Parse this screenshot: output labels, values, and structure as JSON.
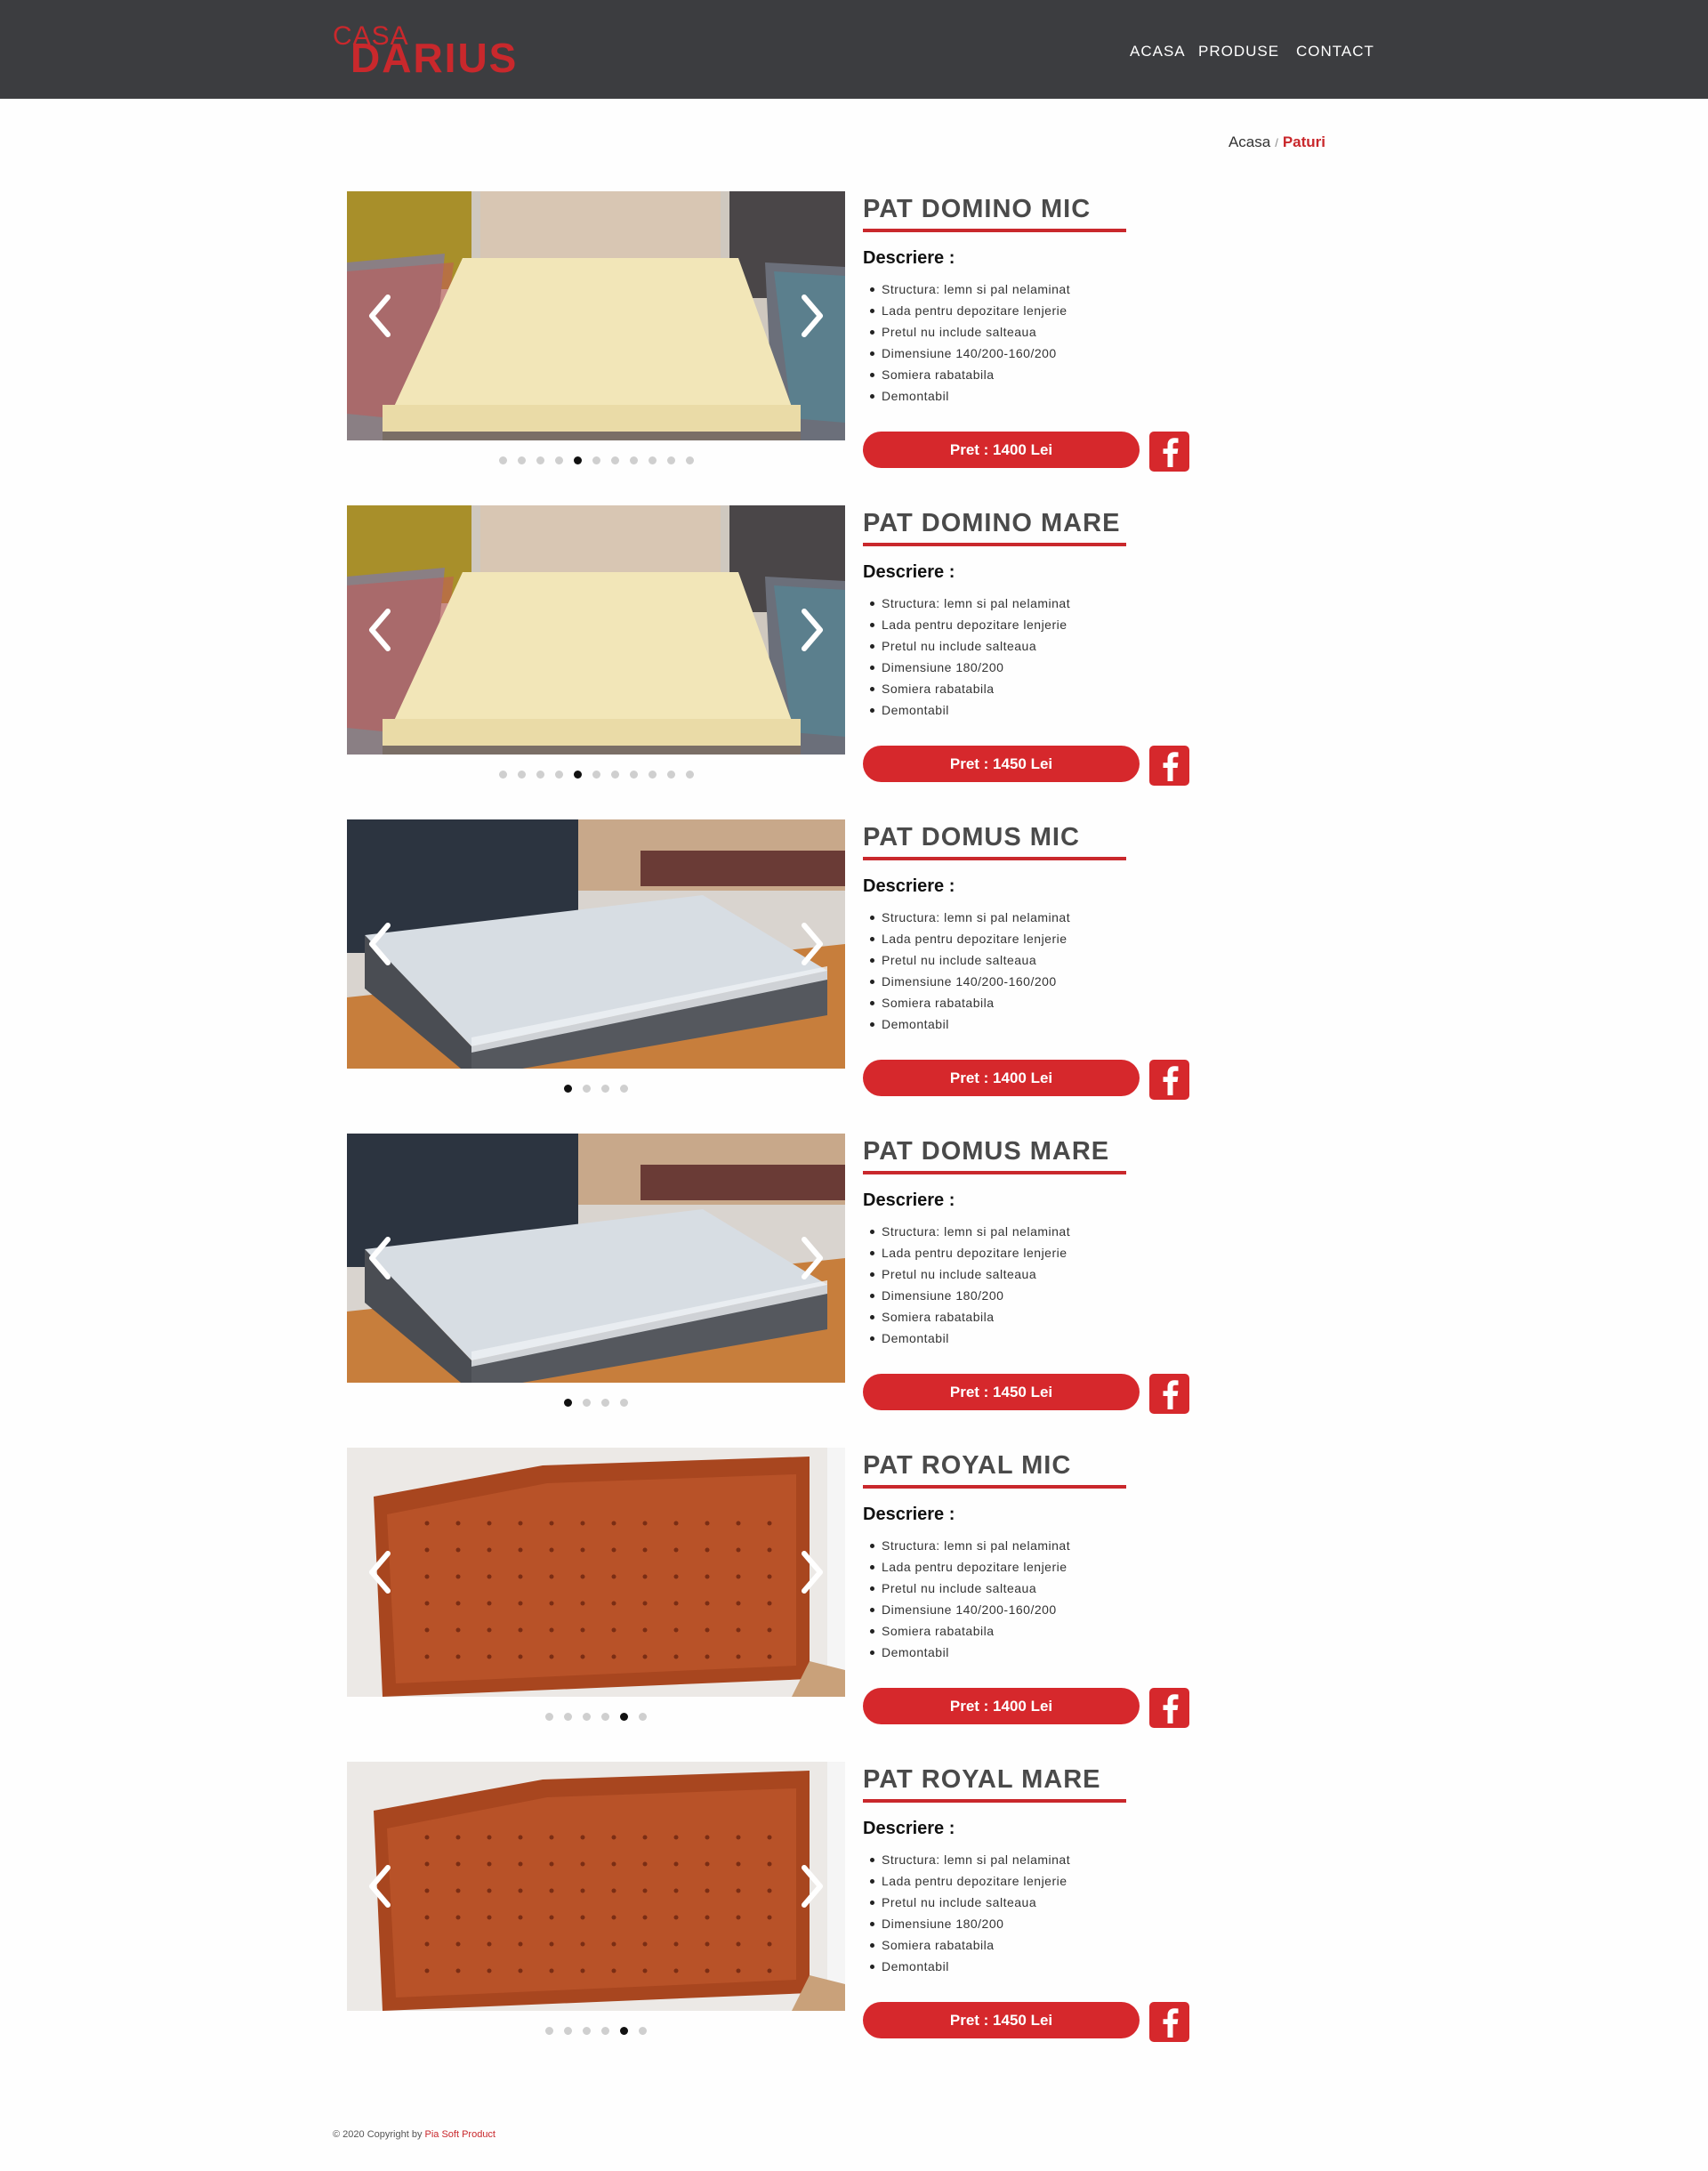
{
  "header": {
    "logo_top": "CASA",
    "logo_bottom": "DARIUS",
    "nav": [
      {
        "label": "ACASA"
      },
      {
        "label": "PRODUSE"
      },
      {
        "label": "CONTACT"
      }
    ]
  },
  "breadcrumb": {
    "home": "Acasa",
    "separator": "/",
    "current": "Paturi"
  },
  "products": [
    {
      "title": "PAT DOMINO MIC",
      "desc_label": "Descriere :",
      "features": [
        "Structura: lemn si pal nelaminat",
        "Lada pentru depozitare lenjerie",
        "Pretul nu include salteaua",
        "Dimensiune 140/200-160/200",
        "Somiera rabatabila",
        "Demontabil"
      ],
      "price": "Pret : 1400 Lei",
      "image": "cream-bed",
      "slides": 11,
      "active_slide": 5
    },
    {
      "title": "PAT DOMINO MARE",
      "desc_label": "Descriere :",
      "features": [
        "Structura: lemn si pal nelaminat",
        "Lada pentru depozitare lenjerie",
        "Pretul nu include salteaua",
        "Dimensiune 180/200",
        "Somiera rabatabila",
        "Demontabil"
      ],
      "price": "Pret : 1450 Lei",
      "image": "cream-bed",
      "slides": 11,
      "active_slide": 5
    },
    {
      "title": "PAT DOMUS MIC",
      "desc_label": "Descriere :",
      "features": [
        "Structura: lemn si pal nelaminat",
        "Lada pentru depozitare lenjerie",
        "Pretul nu include salteaua",
        "Dimensiune 140/200-160/200",
        "Somiera rabatabila",
        "Demontabil"
      ],
      "price": "Pret : 1400 Lei",
      "image": "grey-bed",
      "slides": 4,
      "active_slide": 1
    },
    {
      "title": "PAT DOMUS MARE",
      "desc_label": "Descriere :",
      "features": [
        "Structura: lemn si pal nelaminat",
        "Lada pentru depozitare lenjerie",
        "Pretul nu include salteaua",
        "Dimensiune 180/200",
        "Somiera rabatabila",
        "Demontabil"
      ],
      "price": "Pret : 1450 Lei",
      "image": "grey-bed",
      "slides": 4,
      "active_slide": 1
    },
    {
      "title": "PAT ROYAL MIC",
      "desc_label": "Descriere :",
      "features": [
        "Structura: lemn si pal nelaminat",
        "Lada pentru depozitare lenjerie",
        "Pretul nu include salteaua",
        "Dimensiune 140/200-160/200",
        "Somiera rabatabila",
        "Demontabil"
      ],
      "price": "Pret : 1400 Lei",
      "image": "red-headboard",
      "slides": 6,
      "active_slide": 5
    },
    {
      "title": "PAT ROYAL MARE",
      "desc_label": "Descriere :",
      "features": [
        "Structura: lemn si pal nelaminat",
        "Lada pentru depozitare lenjerie",
        "Pretul nu include salteaua",
        "Dimensiune 180/200",
        "Somiera rabatabila",
        "Demontabil"
      ],
      "price": "Pret : 1450 Lei",
      "image": "red-headboard",
      "slides": 6,
      "active_slide": 5
    }
  ],
  "footer": {
    "text": "© 2020 Copyright by ",
    "brand": "Pia Soft Product"
  },
  "colors": {
    "header_bg": "#3c3d40",
    "accent": "#d6282c",
    "title": "#4a4a4a"
  }
}
